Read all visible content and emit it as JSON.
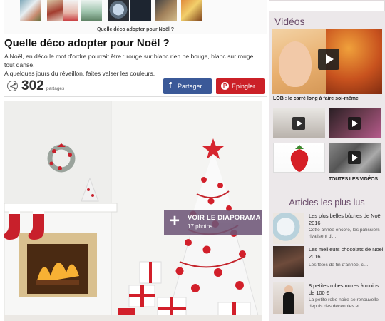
{
  "thumbnail_strip": {
    "caption": "Quelle déco adopter pour Noël ?"
  },
  "article": {
    "title": "Quelle déco adopter pour Noël ?",
    "intro_line1": "A Noël, en déco le mot d'ordre pourrait être : rouge sur blanc rien ne bouge, blanc sur rouge... tout danse.",
    "intro_line2": "A quelques jours du réveillon, faites valser les couleurs."
  },
  "share": {
    "count": "302",
    "unit": "partages",
    "facebook_label": "Partager",
    "facebook_icon": "f",
    "pinterest_label": "Epingler",
    "pinterest_icon": "P"
  },
  "hero": {
    "slideshow_label": "VOIR LE DIAPORAMA",
    "slideshow_count": "17 photos"
  },
  "sidebar": {
    "videos_title": "Vidéos",
    "video_caption": "LOB : le carré long à faire soi-même",
    "all_videos": "TOUTES LES VIDÉOS",
    "most_read_title": "Articles les plus lus",
    "most_read": [
      {
        "title": "Les plus belles bûches de Noël 2016",
        "excerpt": "Cette année encore, les pâtissiers rivalisent d'..."
      },
      {
        "title": "Les meilleurs chocolats de Noël 2016",
        "excerpt": "Les fêtes de fin d'année, c'..."
      },
      {
        "title": "8 petites robes noires à moins de 100 €",
        "excerpt": "La petite robe noire se renouvelle depuis des décennies et ..."
      }
    ]
  },
  "colors": {
    "facebook": "#3b5998",
    "pinterest": "#cb2027",
    "sidebar_accent": "#6b4d6b",
    "diaporama_overlay": "#6e5678"
  }
}
